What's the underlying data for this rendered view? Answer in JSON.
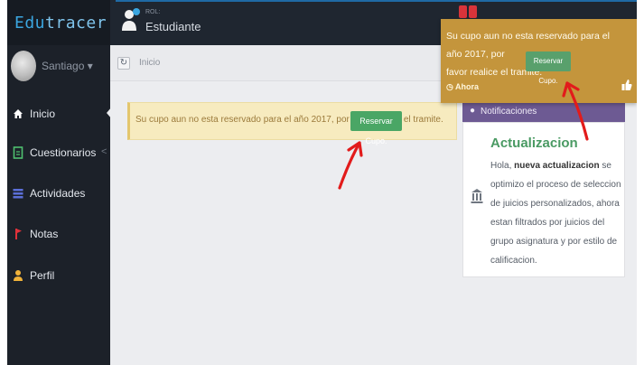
{
  "brand": {
    "name_prefix": "Edu",
    "name_suffix": "tracer"
  },
  "role": {
    "label": "ROL:",
    "name": "Estudiante"
  },
  "user": {
    "name": "Santiago ▾"
  },
  "sidebar": {
    "items": [
      {
        "label": "Inicio",
        "icon": "home-icon"
      },
      {
        "label": "Cuestionarios",
        "icon": "document-icon",
        "chevron": "<"
      },
      {
        "label": "Actividades",
        "icon": "list-icon"
      },
      {
        "label": "Notas",
        "icon": "flag-icon"
      },
      {
        "label": "Perfil",
        "icon": "user-icon"
      }
    ]
  },
  "breadcrumb": {
    "label": "Inicio"
  },
  "alert": {
    "text": "Su cupo aun no esta reservado para el año 2017, por favor realice el tramite.",
    "button": "Reservar Cupo."
  },
  "toast": {
    "line1": "Su cupo aun no esta reservado para el año 2017, por",
    "line2": "favor realice el tramite.",
    "button": "Reservar Cupo.",
    "time": "Ahora"
  },
  "notifications": {
    "header": "Notificaciones",
    "title": "Actualizacion",
    "text_prefix": "Hola, ",
    "text_bold": "nueva actualizacion",
    "text_rest": " se optimizo el proceso de seleccion de juicios personalizados, ahora estan filtrados por juicios del grupo asignatura y por estilo de calificacion."
  },
  "colors": {
    "topbar": "#1f2630",
    "sidebar": "#1c2129",
    "brand_blue": "#3ba6e0",
    "alert_bg": "#f7ebbf",
    "toast_bg": "#c4953c",
    "button_green": "#4aa665",
    "notif_header": "#6d5a93",
    "notif_title": "#4a9a63",
    "arrow_red": "#e21b1b"
  }
}
